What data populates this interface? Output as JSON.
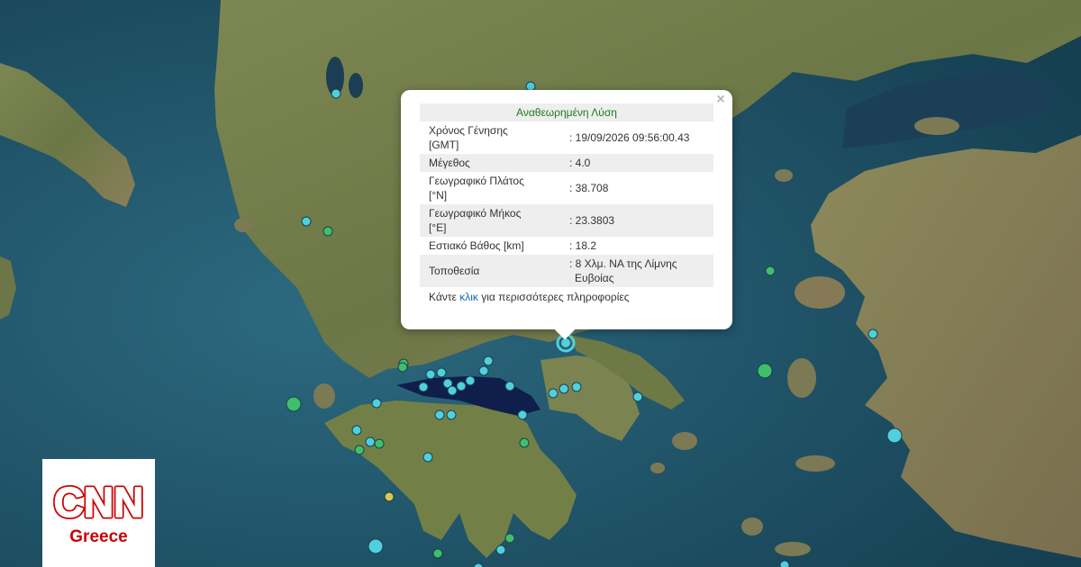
{
  "popup": {
    "title": "Αναθεωρημένη Λύση",
    "close_symbol": "×",
    "rows": [
      {
        "label_line1": "Χρόνος Γένησης",
        "label_line2": "[GMT]",
        "value": ": 19/09/2026 09:56:00.43"
      },
      {
        "label_line1": "Μέγεθος",
        "label_line2": "",
        "value": ": 4.0"
      },
      {
        "label_line1": "Γεωγραφικό Πλάτος",
        "label_line2": "[°N]",
        "value": ": 38.708"
      },
      {
        "label_line1": "Γεωγραφικό Μήκος",
        "label_line2": "[°E]",
        "value": ": 23.3803"
      },
      {
        "label_line1": "Εστιακό Βάθος [km]",
        "label_line2": "",
        "value": ": 18.2"
      },
      {
        "label_line1": "Τοποθεσία",
        "label_line2": "",
        "value_line1": ": 8 Χλμ. ΝΑ της Λίμνης",
        "value_line2": "Ευβοίας"
      }
    ],
    "more_prefix": "Κάντε ",
    "more_link": "κλικ",
    "more_suffix": " για περισσότερες πληροφορίες"
  },
  "logo": {
    "brand": "CNN",
    "subtitle": "Greece",
    "color": "#cc0000"
  },
  "map_colors": {
    "sea": "#1d4a5e",
    "land": "#6f7a4e",
    "marker_cyan": "#4fd0dc",
    "marker_green": "#3fbf6a",
    "marker_yellow": "#d8c94a",
    "gulf": "#0f1e4a"
  }
}
